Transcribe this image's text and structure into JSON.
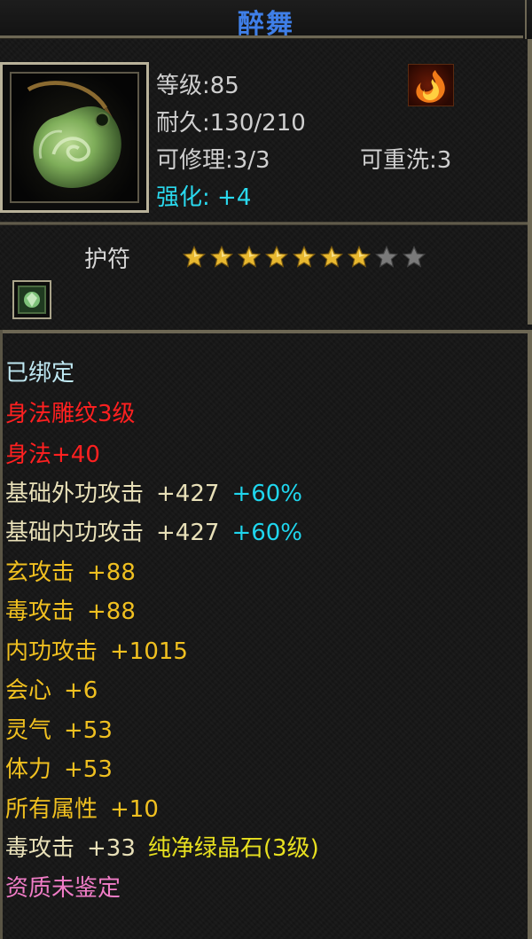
{
  "item": {
    "name": "醉舞",
    "level": "等级:85",
    "durability": "耐久:130/210",
    "repairable": "可修理:3/3",
    "rewashable": "可重洗:3",
    "enhance_label": "强化:",
    "enhance_value": "+4",
    "type": "护符",
    "stars_total": 9,
    "stars_filled": 7
  },
  "colors": {
    "title": "#3f7fe8",
    "enhance": "#2ad9ee",
    "star_gold": "#e8b830",
    "star_gray": "#7a7a7a"
  },
  "icons": {
    "element": "fire-element-icon",
    "item": "jade-pendant-icon",
    "gem": "gem-slot-icon"
  },
  "attributes": {
    "bound": "已绑定",
    "engraving": "身法雕纹3级",
    "agility": "身法+40",
    "outer_attack_label": "基础外功攻击",
    "outer_attack_value": "+427",
    "outer_attack_pct": "+60%",
    "inner_attack_label": "基础内功攻击",
    "inner_attack_value": "+427",
    "inner_attack_pct": "+60%",
    "xuan_attack_label": "玄攻击",
    "xuan_attack_value": "+88",
    "poison_attack_label": "毒攻击",
    "poison_attack_value": "+88",
    "inner_power_label": "内功攻击",
    "inner_power_value": "+1015",
    "crit_label": "会心",
    "crit_value": "+6",
    "spirit_label": "灵气",
    "spirit_value": "+53",
    "stamina_label": "体力",
    "stamina_value": "+53",
    "all_attr_label": "所有属性",
    "all_attr_value": "+10",
    "gem_poison_label": "毒攻击",
    "gem_poison_value": "+33",
    "gem_name": "纯净绿晶石(3级)",
    "quality": "资质未鉴定"
  }
}
